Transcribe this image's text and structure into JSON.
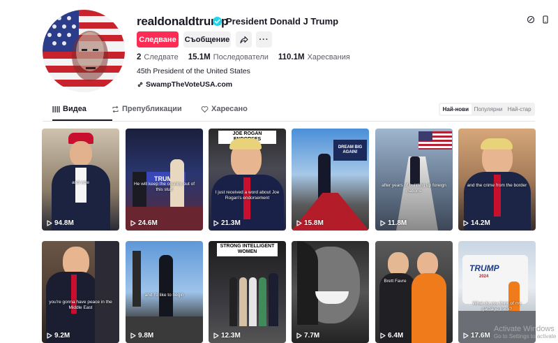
{
  "profile": {
    "username": "realdonaldtrump",
    "nickname": "President Donald J Trump",
    "bio": "45th President of the United States",
    "link": "SwampTheVoteUSA.com",
    "verified": true
  },
  "actions": {
    "follow_label": "Следване",
    "message_label": "Съобщение",
    "share_icon": "share-icon",
    "more_label": "···"
  },
  "stats": {
    "following_count": "2",
    "following_label": "Следвате",
    "followers_count": "15.1M",
    "followers_label": "Последователи",
    "likes_count": "110.1M",
    "likes_label": "Харесвания"
  },
  "tabs": [
    {
      "label": "Видеа",
      "icon": "grid-icon",
      "active": true
    },
    {
      "label": "Препубликации",
      "icon": "repost-icon",
      "active": false
    },
    {
      "label": "Харесано",
      "icon": "heart-outline-icon",
      "active": false
    }
  ],
  "sort": {
    "options": [
      "Най-нови",
      "Популярни",
      "Най-стар"
    ],
    "selected": "Най-нови"
  },
  "videos": [
    {
      "views": "94.8M",
      "caption": "and vote",
      "banner": ""
    },
    {
      "views": "24.6M",
      "caption": "He will keep the country out of this stuff",
      "banner": ""
    },
    {
      "views": "21.3M",
      "caption": "I just received a word about Joe Rogan's endorsement",
      "banner": "JOE ROGAN ENDORSES"
    },
    {
      "views": "15.8M",
      "caption": "",
      "banner": ""
    },
    {
      "views": "11.8M",
      "caption": "after years of building up foreign nations",
      "banner": ""
    },
    {
      "views": "14.2M",
      "caption": "and the crime from the border",
      "banner": ""
    },
    {
      "views": "9.2M",
      "caption": "you're gonna have peace in the Middle East",
      "banner": ""
    },
    {
      "views": "9.8M",
      "caption": "and I'd like to begin",
      "banner": ""
    },
    {
      "views": "12.3M",
      "caption": "",
      "banner": "STRONG INTELLIGENT WOMEN"
    },
    {
      "views": "7.7M",
      "caption": "",
      "banner": ""
    },
    {
      "views": "6.4M",
      "caption": "Brett Favre",
      "banner": ""
    },
    {
      "views": "17.6M",
      "caption": "What do you think of my garbage truck?",
      "banner": ""
    }
  ],
  "signs": {
    "rally_sign": "TRUMP",
    "dream_sign": "DREAM BIG AGAIN!",
    "truck_logo": "TRUMP",
    "truck_year": "2024"
  },
  "watermark": {
    "title": "Activate Windows",
    "subtitle": "Go to Settings to activate"
  },
  "colors": {
    "brand_red": "#fe2c55",
    "verified_blue": "#20d5ec",
    "text_primary": "#161823",
    "text_secondary": "#5c5e66"
  }
}
